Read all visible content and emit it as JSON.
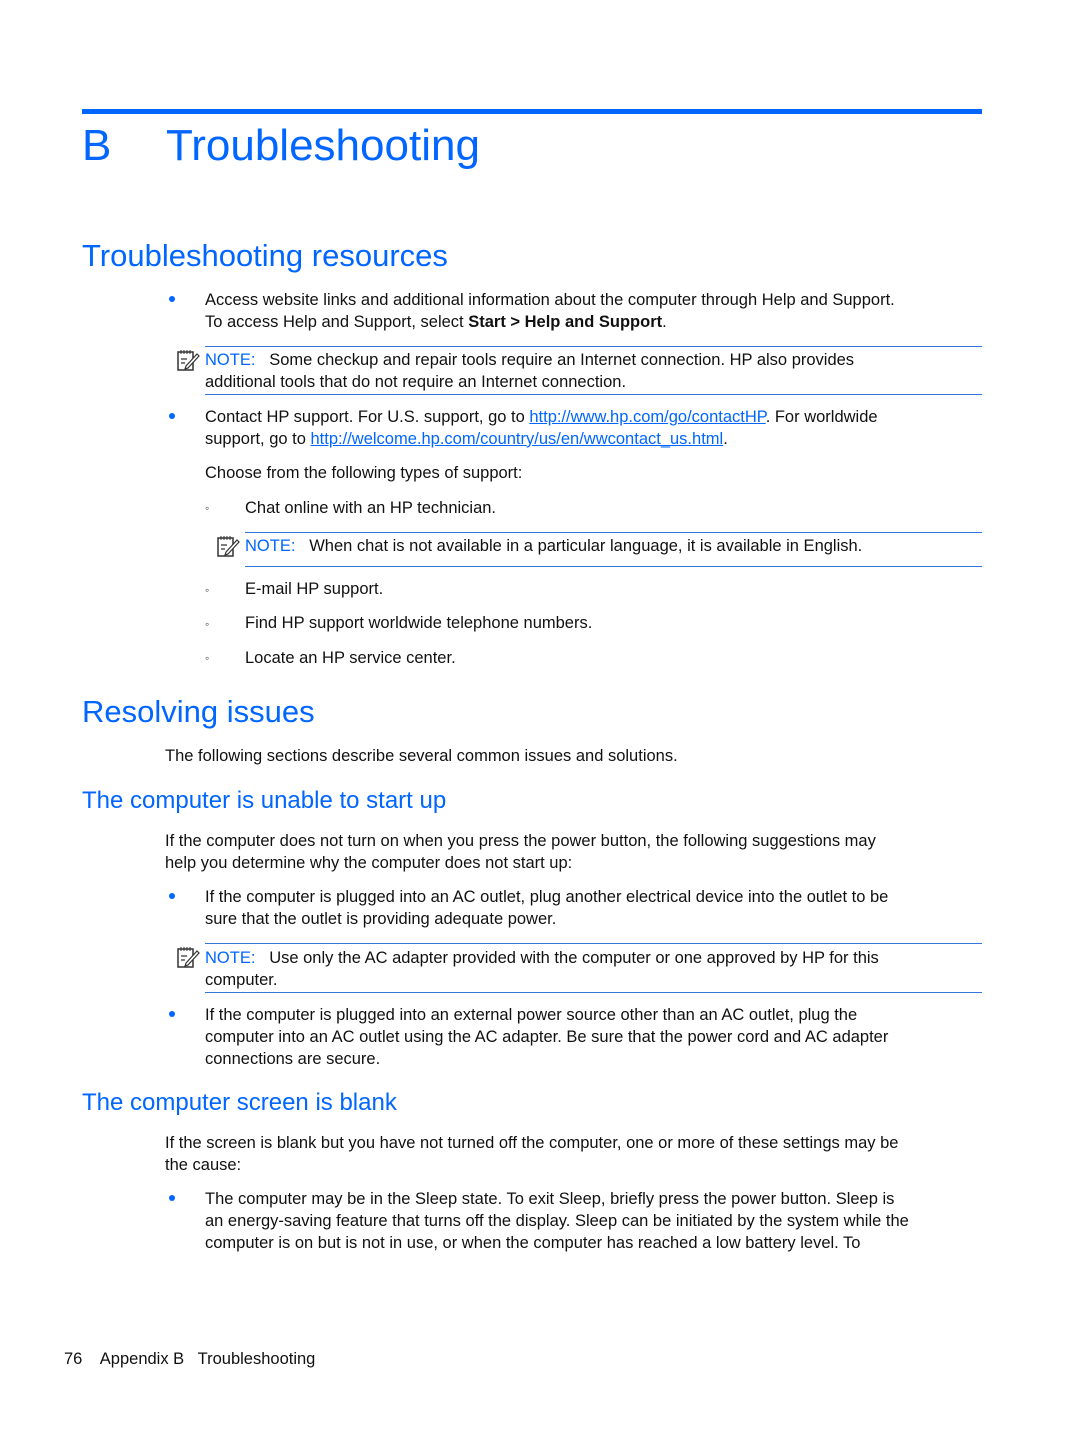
{
  "chapter": {
    "letter": "B",
    "title": "Troubleshooting"
  },
  "sections": {
    "resources": {
      "title": "Troubleshooting resources",
      "bullet1": {
        "line1": "Access website links and additional information about the computer through Help and Support.",
        "line2_prefix": "To access Help and Support, select ",
        "line2_bold": "Start > Help and Support",
        "line2_suffix": "."
      },
      "note1": {
        "label": "NOTE:",
        "line1": "Some checkup and repair tools require an Internet connection. HP also provides",
        "line2": "additional tools that do not require an Internet connection."
      },
      "bullet2": {
        "prefix": "Contact HP support. For U.S. support, go to ",
        "link1": "http://www.hp.com/go/contactHP",
        "mid": ". For worldwide",
        "line2_prefix": "support, go to ",
        "link2": "http://welcome.hp.com/country/us/en/wwcontact_us.html",
        "line2_suffix": "."
      },
      "choose_text": "Choose from the following types of support:",
      "sub_items": [
        "Chat online with an HP technician.",
        "E-mail HP support.",
        "Find HP support worldwide telephone numbers.",
        "Locate an HP service center."
      ],
      "note2": {
        "label": "NOTE:",
        "text": "When chat is not available in a particular language, it is available in English."
      }
    },
    "resolving": {
      "title": "Resolving issues",
      "intro": "The following sections describe several common issues and solutions."
    },
    "startup": {
      "title": "The computer is unable to start up",
      "intro_line1": "If the computer does not turn on when you press the power button, the following suggestions may",
      "intro_line2": "help you determine why the computer does not start up:",
      "bullet1_line1": "If the computer is plugged into an AC outlet, plug another electrical device into the outlet to be",
      "bullet1_line2": "sure that the outlet is providing adequate power.",
      "note": {
        "label": "NOTE:",
        "line1": "Use only the AC adapter provided with the computer or one approved by HP for this",
        "line2": "computer."
      },
      "bullet2_line1": "If the computer is plugged into an external power source other than an AC outlet, plug the",
      "bullet2_line2": "computer into an AC outlet using the AC adapter. Be sure that the power cord and AC adapter",
      "bullet2_line3": "connections are secure."
    },
    "blank": {
      "title": "The computer screen is blank",
      "intro_line1": "If the screen is blank but you have not turned off the computer, one or more of these settings may be",
      "intro_line2": "the cause:",
      "bullet1_line1": "The computer may be in the Sleep state. To exit Sleep, briefly press the power button. Sleep is",
      "bullet1_line2": "an energy-saving feature that turns off the display. Sleep can be initiated by the system while the",
      "bullet1_line3": "computer is on but is not in use, or when the computer has reached a low battery level. To"
    }
  },
  "footer": {
    "page_number": "76",
    "label": "Appendix B   Troubleshooting"
  },
  "colors": {
    "accent": "#0066ff",
    "text": "#111111"
  }
}
